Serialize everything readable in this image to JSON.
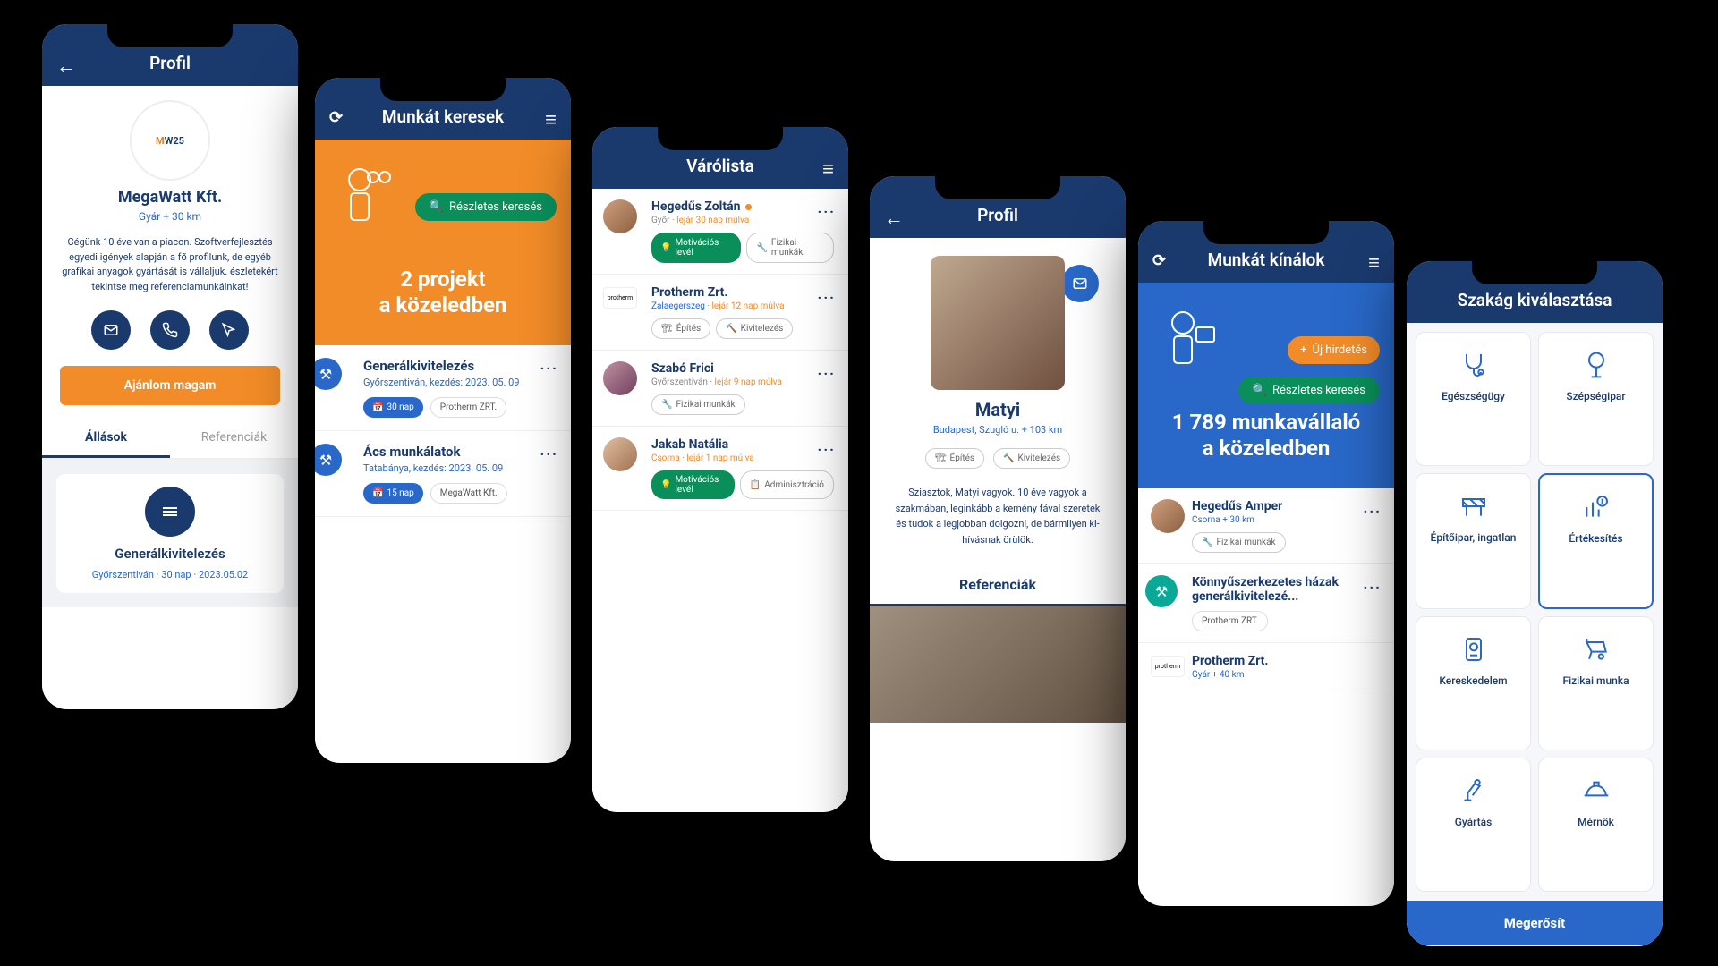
{
  "phone1": {
    "title": "Profil",
    "company": "MegaWatt Kft.",
    "location": "Gyár + 30 km",
    "description": "Cégünk 10 éve van a piacon. Szoftverfejlesztés egyedi igények alapján a fő profilunk, de egyéb grafikai anyagok gyártását is vállaljuk. észletekért tekintse meg referenciamunkáinkat!",
    "cta": "Ajánlom magam",
    "tab1": "Állások",
    "tab2": "Referenciák",
    "job_title": "Generálkivitelezés",
    "job_meta": "Győrszentiván  ·  30 nap  ·  2023.05.02"
  },
  "phone2": {
    "title": "Munkát keresek",
    "search": "Részletes keresés",
    "hero": "2 projekt\na közeledben",
    "item1_title": "Generálkivitelezés",
    "item1_sub": "Győrszentiván, kezdés: 2023. 05. 09",
    "item1_chip1": "30 nap",
    "item1_chip2": "Protherm ZRT.",
    "item2_title": "Ács munkálatok",
    "item2_sub": "Tatabánya, kezdés: 2023. 05. 09",
    "item2_chip1": "15 nap",
    "item2_chip2": "MegaWatt Kft."
  },
  "phone3": {
    "title": "Várólista",
    "p1_name": "Hegedűs Zoltán",
    "p1_loc": "Győr",
    "p1_exp": "lejár 30 nap múlva",
    "p1_tag1": "Motivációs levél",
    "p1_tag2": "Fizikai munkák",
    "p2_name": "Protherm Zrt.",
    "p2_loc": "Zalaegerszeg",
    "p2_exp": "lejár 12 nap múlva",
    "p2_tag1": "Építés",
    "p2_tag2": "Kivitelezés",
    "p3_name": "Szabó Frici",
    "p3_loc": "Győrszentiván",
    "p3_exp": "lejár 9 nap múlva",
    "p3_tag1": "Fizikai munkák",
    "p4_name": "Jakab Natália",
    "p4_loc": "Csorna",
    "p4_exp": "lejár 1 nap múlva",
    "p4_tag1": "Motivációs levél",
    "p4_tag2": "Adminisztráció"
  },
  "phone4": {
    "title": "Profil",
    "name": "Matyi",
    "location": "Budapest, Szugló u. + 103 km",
    "tag1": "Építés",
    "tag2": "Kivitelezés",
    "description": "Sziasztok, Matyi vagyok. 10 éve vagyok a szakmában, leginkább a kemény fával szeretek és tudok a legjobban dolgozni, de bármilyen ki-hívásnak örülök.",
    "references": "Referenciák"
  },
  "phone5": {
    "title": "Munkát kínálok",
    "new_ad": "Új hirdetés",
    "search": "Részletes keresés",
    "hero": "1 789 munkavállaló\na közeledben",
    "w1_name": "Hegedűs Amper",
    "w1_sub": "Csorna + 30 km",
    "w1_tag": "Fizikai munkák",
    "w2_name": "Könnyűszerkezetes házak generálkivitelezé...",
    "w2_tag": "Protherm ZRT.",
    "w3_name": "Protherm Zrt.",
    "w3_sub": "Gyár + 40 km"
  },
  "phone6": {
    "title": "Szakág kiválasztása",
    "c1": "Egészségügy",
    "c2": "Szépségipar",
    "c3": "Építőipar, ingatlan",
    "c4": "Értékesítés",
    "c5": "Kereskedelem",
    "c6": "Fizikai munka",
    "c7": "Gyártás",
    "c8": "Mérnök",
    "confirm": "Megerősít"
  }
}
